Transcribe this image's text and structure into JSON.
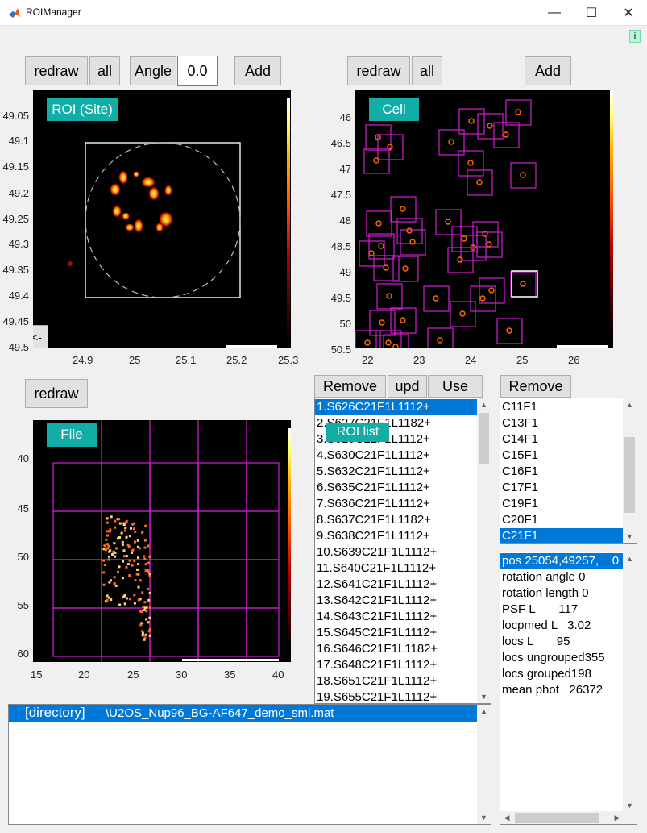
{
  "window": {
    "title": "ROIManager",
    "minimize": "—",
    "maximize": "☐",
    "close": "✕",
    "info": "i"
  },
  "roi_panel": {
    "redraw": "redraw",
    "all": "all",
    "angle_label": "Angle",
    "angle_value": "0.0",
    "add": "Add",
    "label": "ROI (Site)",
    "back": "<-",
    "y_ticks": [
      "49.05",
      "49.1",
      "49.15",
      "49.2",
      "49.25",
      "49.3",
      "49.35",
      "49.4",
      "49.45",
      "49.5"
    ],
    "x_ticks": [
      "24.9",
      "25",
      "25.1",
      "25.2",
      "25.3"
    ]
  },
  "cell_panel": {
    "redraw": "redraw",
    "all": "all",
    "add": "Add",
    "label": "Cell",
    "y_ticks": [
      "46",
      "46.5",
      "47",
      "47.5",
      "48",
      "48.5",
      "49",
      "49.5",
      "50",
      "50.5"
    ],
    "x_ticks": [
      "22",
      "23",
      "24",
      "25",
      "26"
    ]
  },
  "file_panel": {
    "redraw": "redraw",
    "label": "File",
    "y_ticks": [
      "40",
      "45",
      "50",
      "55",
      "60"
    ],
    "x_ticks": [
      "15",
      "20",
      "25",
      "30",
      "35",
      "40"
    ]
  },
  "roi_list": {
    "remove": "Remove",
    "upd": "upd",
    "use": "Use",
    "label": "ROI list",
    "items": [
      "1.S626C21F1L1112+",
      "2.S627C21F1L1182+",
      "3.S629C21F1L1112+",
      "4.S630C21F1L1112+",
      "5.S632C21F1L1112+",
      "6.S635C21F1L1112+",
      "7.S636C21F1L1112+",
      "8.S637C21F1L1182+",
      "9.S638C21F1L1112+",
      "10.S639C21F1L1112+",
      "11.S640C21F1L1112+",
      "12.S641C21F1L1112+",
      "13.S642C21F1L1112+",
      "14.S643C21F1L1112+",
      "15.S645C21F1L1112+",
      "16.S646C21F1L1182+",
      "17.S648C21F1L1112+",
      "18.S651C21F1L1112+",
      "19.S655C21F1L1112+"
    ]
  },
  "cell_list": {
    "remove": "Remove",
    "items": [
      "C11F1",
      "C13F1",
      "C14F1",
      "C15F1",
      "C16F1",
      "C17F1",
      "C19F1",
      "C20F1",
      "C21F1"
    ]
  },
  "info_list": {
    "items": [
      "pos 25054,49257,    0",
      "rotation angle 0",
      "rotation length 0",
      "PSF L       117",
      "locpmed L   3.02",
      "locs L       95",
      "locs ungrouped355",
      "locs grouped198",
      "mean phot   26372"
    ]
  },
  "file_list": {
    "directory_label": "[directory]",
    "file_name": "\\U2OS_Nup96_BG-AF647_demo_sml.mat"
  },
  "colors": {
    "accent_teal": "#12ada6",
    "selection_blue": "#0078d7",
    "magenta_box": "#e020e0"
  }
}
